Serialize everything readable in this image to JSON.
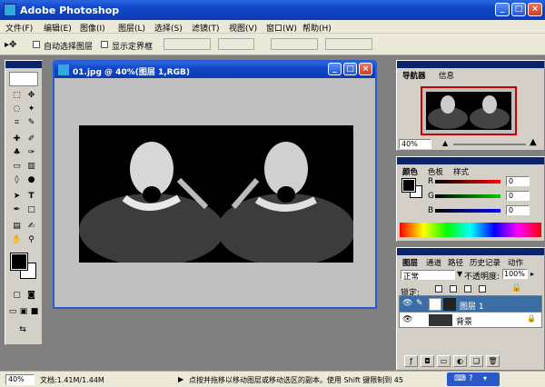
{
  "app": {
    "title": "Adobe Photoshop"
  },
  "menu": [
    "文件(F)",
    "编辑(E)",
    "图像(I)",
    "图层(L)",
    "选择(S)",
    "滤镜(T)",
    "视图(V)",
    "窗口(W)",
    "帮助(H)"
  ],
  "options": {
    "auto_select": "自动选择图层",
    "show_bounds": "显示定界框"
  },
  "document": {
    "title": "01.jpg @ 40%(图层 1,RGB)"
  },
  "navigator": {
    "tabs": [
      "导航器",
      "信息"
    ],
    "zoom": "40%"
  },
  "color": {
    "tabs": [
      "颜色",
      "色板",
      "样式"
    ],
    "channels": [
      {
        "label": "R",
        "value": "0",
        "color": "#ff0000"
      },
      {
        "label": "G",
        "value": "0",
        "color": "#00a000"
      },
      {
        "label": "B",
        "value": "0",
        "color": "#0000ff"
      }
    ]
  },
  "layers_panel": {
    "tabs": [
      "图层",
      "通道",
      "路径",
      "历史记录",
      "动作"
    ],
    "blend_mode": "正常",
    "opacity_label": "不透明度:",
    "opacity": "100%",
    "lock_label": "锁定:",
    "layers": [
      {
        "name": "图层 1",
        "selected": true
      },
      {
        "name": "背景",
        "selected": false
      }
    ]
  },
  "status": {
    "zoom": "40%",
    "doc_size": "文档:1.41M/1.44M",
    "hint": "点按并拖移以移动图层或移动选区的副本。使用 Shift 键限制到 45"
  }
}
